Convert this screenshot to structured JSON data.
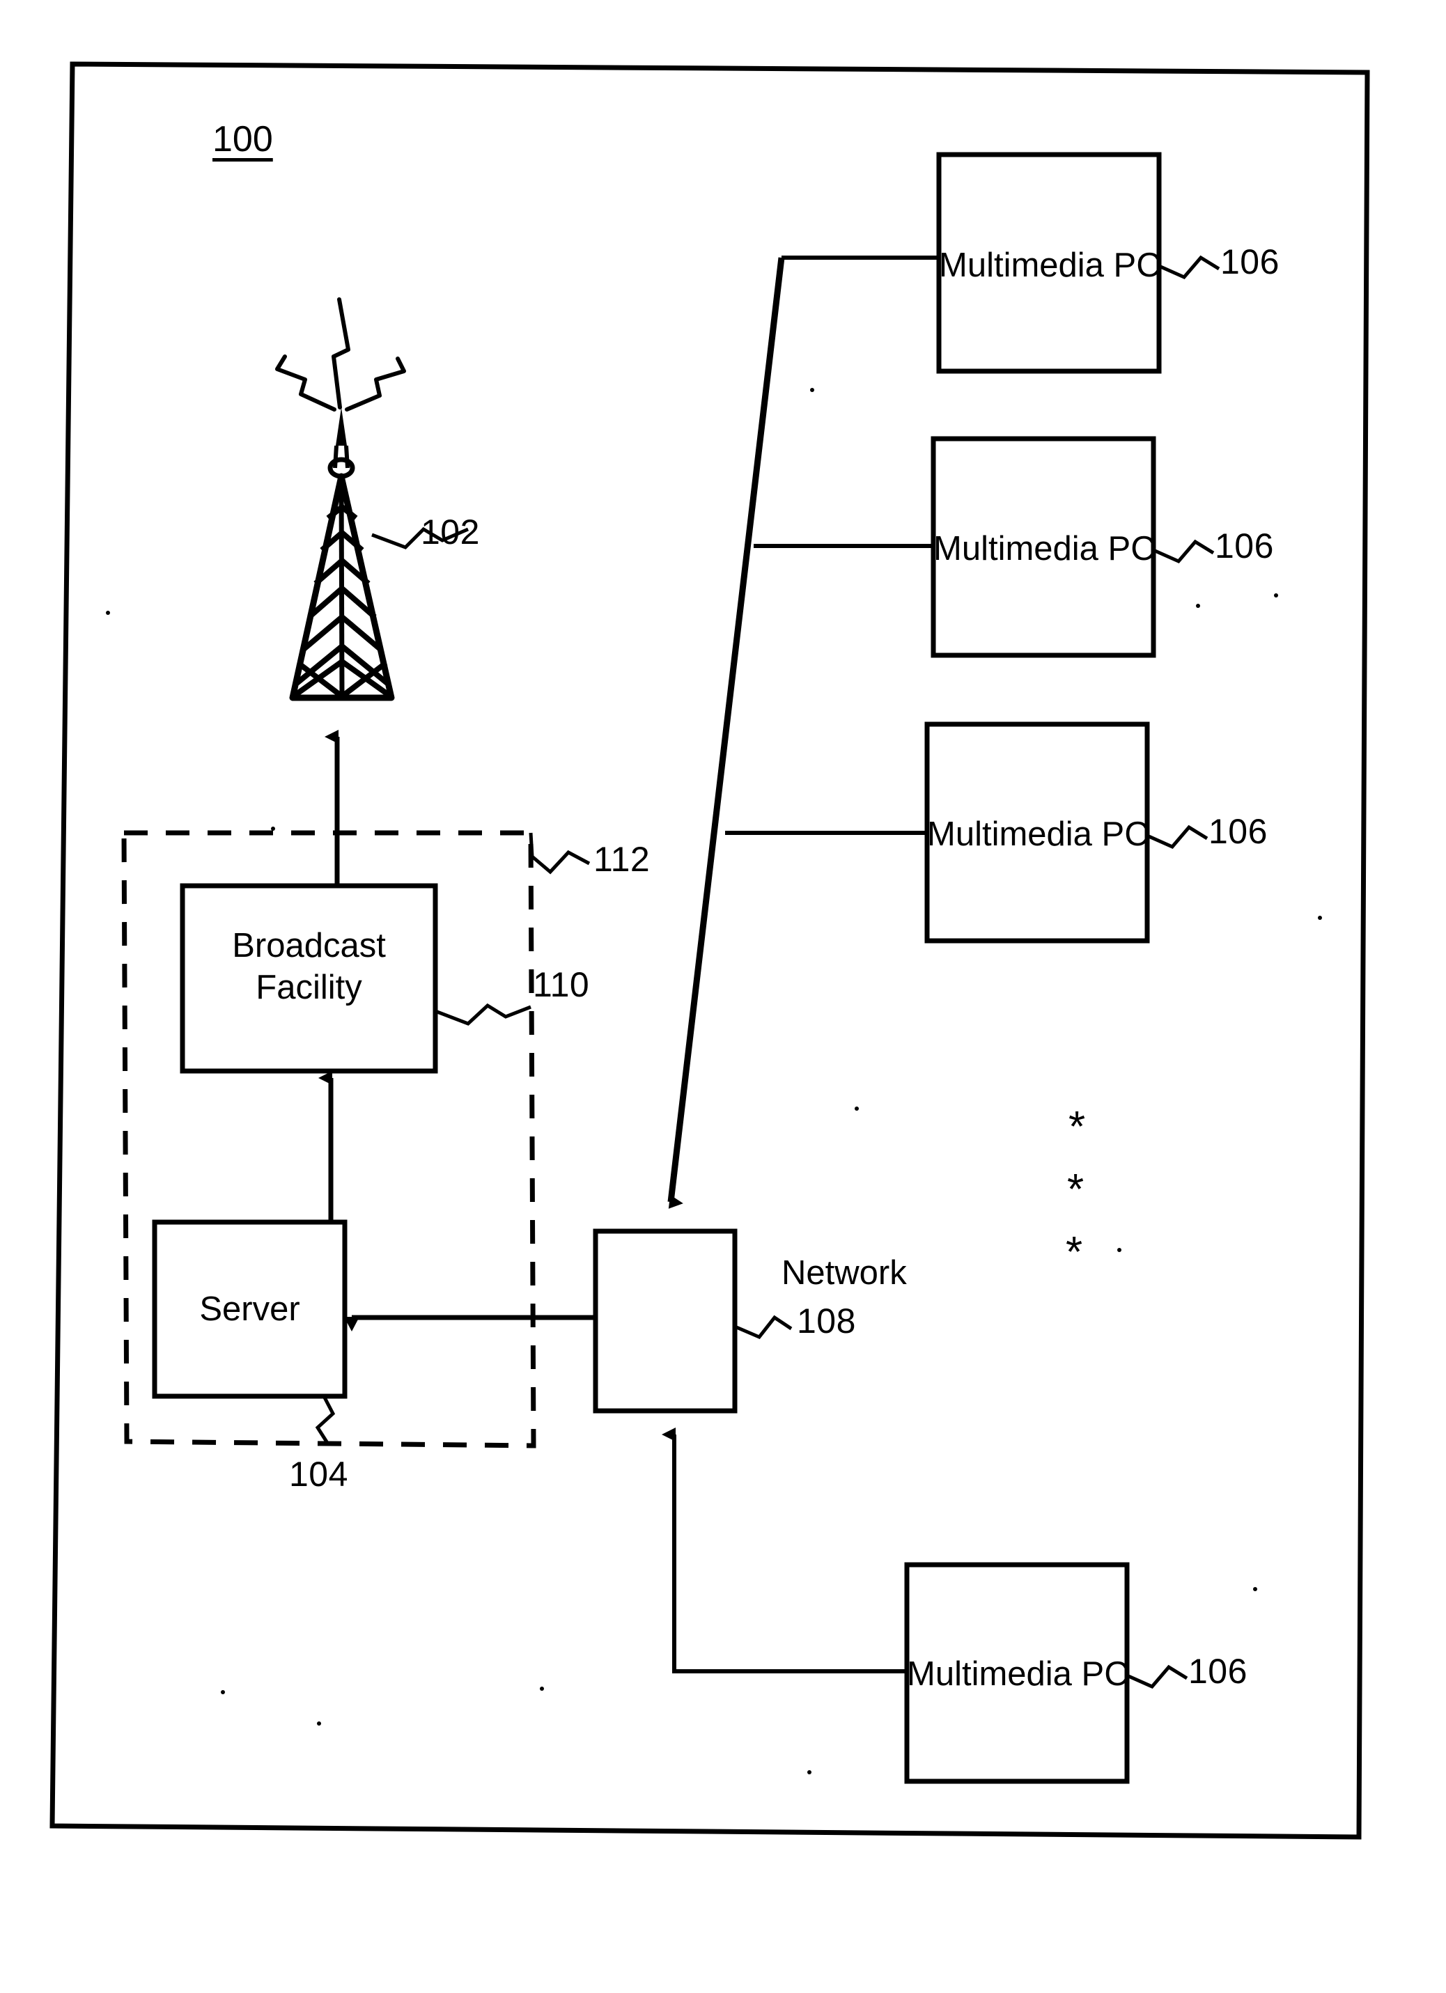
{
  "figure": {
    "number": "100",
    "type": "patent-system-block-diagram"
  },
  "nodes": {
    "tower": {
      "ref": "102",
      "kind": "broadcast-antenna-tower"
    },
    "headend": {
      "ref": "104",
      "kind": "dashed-boundary-group"
    },
    "broadcast_facility": {
      "label_line1": "Broadcast",
      "label_line2": "Facility",
      "ref": "110"
    },
    "server": {
      "label": "Server",
      "ref": "104_group_member"
    },
    "server_label": "Server",
    "link_112": {
      "ref": "112",
      "kind": "transmission-link"
    },
    "network": {
      "label": "Network",
      "ref": "108"
    },
    "pcs": [
      {
        "label": "Multimedia PC",
        "ref": "106"
      },
      {
        "label": "Multimedia PC",
        "ref": "106"
      },
      {
        "label": "Multimedia PC",
        "ref": "106"
      },
      {
        "label": "Multimedia PC",
        "ref": "106"
      }
    ]
  },
  "ellipsis": {
    "glyph": "*",
    "count": 3
  },
  "colors": {
    "ink": "#000000",
    "paper": "#ffffff"
  }
}
